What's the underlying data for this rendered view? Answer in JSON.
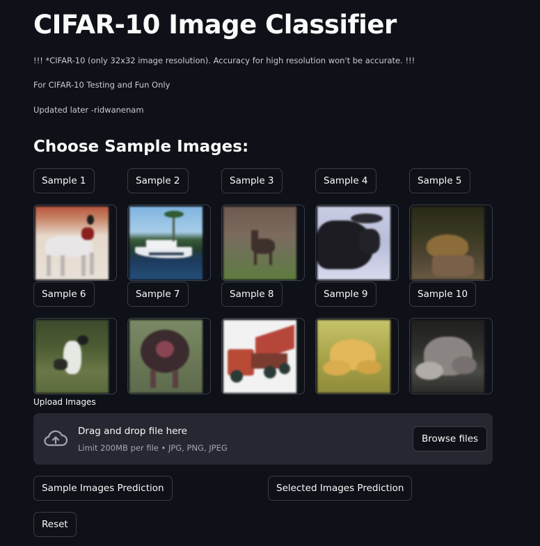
{
  "header": {
    "title": "CIFAR-10 Image Classifier",
    "notes": [
      "!!! *CIFAR-10 (only 32x32 image resolution). Accuracy for high resolution won't be accurate. !!!",
      "For CIFAR-10 Testing and Fun Only",
      "Updated later -ridwanenam"
    ]
  },
  "samples": {
    "heading": "Choose Sample Images:",
    "buttons": [
      "Sample 1",
      "Sample 2",
      "Sample 3",
      "Sample 4",
      "Sample 5",
      "Sample 6",
      "Sample 7",
      "Sample 8",
      "Sample 9",
      "Sample 10"
    ],
    "images": [
      "horse-rider",
      "boat",
      "deer",
      "moose",
      "frog",
      "bird",
      "turkey",
      "truck",
      "frog-yellow",
      "frog-gray"
    ]
  },
  "upload": {
    "label": "Upload Images",
    "drop_text": "Drag and drop file here",
    "limit_text": "Limit 200MB per file • JPG, PNG, JPEG",
    "browse_label": "Browse files"
  },
  "actions": {
    "sample_prediction": "Sample Images Prediction",
    "selected_prediction": "Selected Images Prediction",
    "reset": "Reset"
  },
  "colors": {
    "background": "#0e1117",
    "dropzone": "#262730",
    "border": "#3a3d47",
    "text": "#fafafa"
  }
}
